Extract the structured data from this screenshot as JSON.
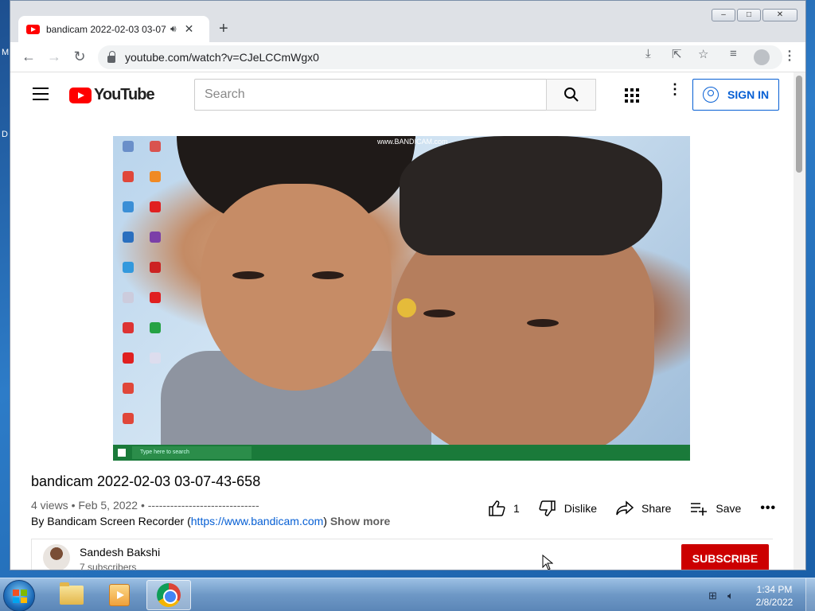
{
  "desktop": {
    "label_top": "M",
    "label_mid": "D"
  },
  "browser": {
    "tab_title": "bandicam 2022-02-03 03-07",
    "tab_audio_icon": "speaker-icon",
    "new_tab_label": "+",
    "url": "youtube.com/watch?v=CJeLCCmWgx0",
    "window_controls": {
      "minimize": "–",
      "maximize": "□",
      "close": "✕"
    }
  },
  "youtube": {
    "logo_text": "YouTube",
    "search_placeholder": "Search",
    "sign_in_label": "SIGN IN",
    "video": {
      "watermark": "www.BANDICAM.com",
      "inner_search_text": "Type here to search",
      "title": "bandicam 2022-02-03 03-07-43-658",
      "meta": "4 views • Feb 5, 2022 • ------------------------------",
      "byline_prefix": "By Bandicam Screen Recorder (",
      "byline_link": "https://www.bandicam.com",
      "byline_suffix": ")",
      "show_more": "Show more"
    },
    "actions": {
      "like_count": "1",
      "dislike_label": "Dislike",
      "share_label": "Share",
      "save_label": "Save",
      "more_label": "•••"
    },
    "channel": {
      "name": "Sandesh Bakshi",
      "subscribers": "7 subscribers",
      "subscribe_label": "SUBSCRIBE"
    }
  },
  "taskbar": {
    "time": "1:34 PM",
    "date": "2/8/2022",
    "apps": [
      "windows-explorer",
      "windows-media-player",
      "google-chrome"
    ]
  },
  "colors": {
    "youtube_red": "#ff0000",
    "link_blue": "#065fd4",
    "subscribe_red": "#cc0000"
  }
}
